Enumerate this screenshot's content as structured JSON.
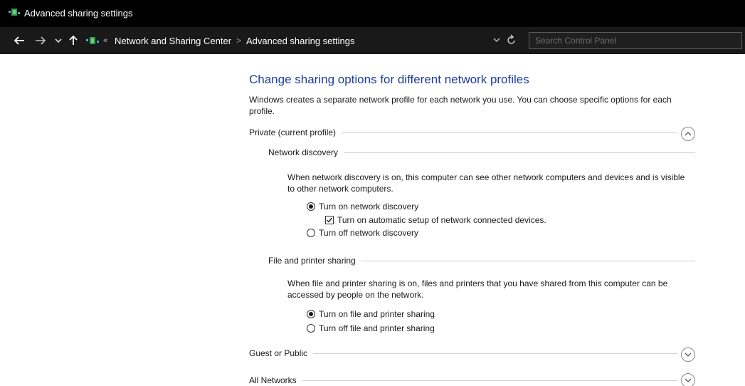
{
  "window": {
    "title": "Advanced sharing settings"
  },
  "addressbar": {
    "chevron": "«",
    "crumbs": [
      "Network and Sharing Center",
      "Advanced sharing settings"
    ],
    "separator": ">",
    "search_placeholder": "Search Control Panel"
  },
  "main": {
    "heading": "Change sharing options for different network profiles",
    "intro": "Windows creates a separate network profile for each network you use. You can choose specific options for each profile.",
    "private": {
      "label": "Private (current profile)",
      "expanded": true,
      "network_discovery": {
        "label": "Network discovery",
        "description": "When network discovery is on, this computer can see other network computers and devices and is visible to other network computers.",
        "on_label": "Turn on network discovery",
        "on_selected": true,
        "auto_setup_label": "Turn on automatic setup of network connected devices.",
        "auto_setup_checked": true,
        "off_label": "Turn off network discovery"
      },
      "file_printer": {
        "label": "File and printer sharing",
        "description": "When file and printer sharing is on, files and printers that you have shared from this computer can be accessed by people on the network.",
        "on_label": "Turn on file and printer sharing",
        "on_selected": true,
        "off_label": "Turn off file and printer sharing"
      }
    },
    "guest": {
      "label": "Guest or Public",
      "expanded": false
    },
    "all": {
      "label": "All Networks",
      "expanded": false
    }
  },
  "icons": {
    "title": "network-icon",
    "back": "arrow-left-icon",
    "forward": "arrow-right-icon",
    "recent": "chevron-down-icon",
    "up": "arrow-up-icon",
    "refresh": "refresh-icon",
    "collapse": "chevron-up-icon",
    "expand": "chevron-down-icon"
  },
  "colors": {
    "heading": "#1e3d9e",
    "titlebar": "#000000",
    "addressbar": "#191919"
  }
}
